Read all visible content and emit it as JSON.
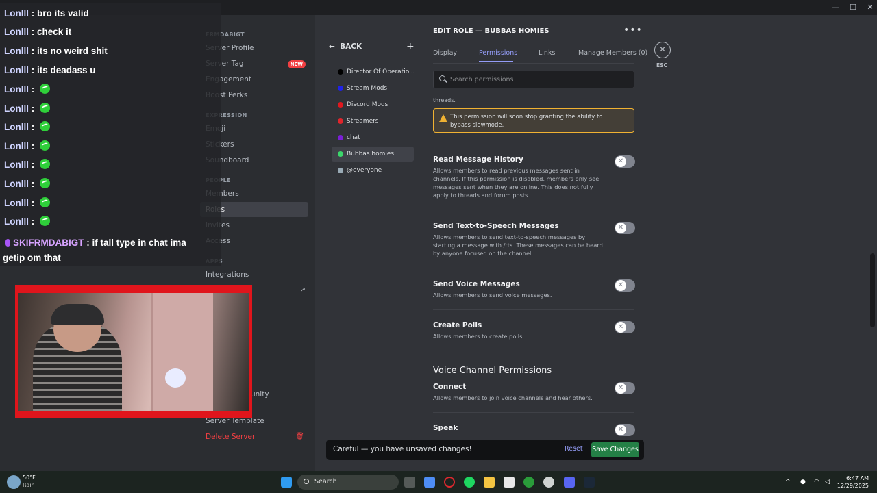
{
  "chat": {
    "lines": [
      {
        "user": "Lonlll",
        "msg": " : bro its valid"
      },
      {
        "user": "Lonlll",
        "msg": " : check it"
      },
      {
        "user": "Lonlll",
        "msg": " : its no weird shit"
      },
      {
        "user": "Lonlll",
        "msg": " : its deadass u"
      },
      {
        "user": "Lonlll",
        "msg": " : "
      },
      {
        "user": "Lonlll",
        "msg": " : "
      },
      {
        "user": "Lonlll",
        "msg": " : "
      },
      {
        "user": "Lonlll",
        "msg": " : "
      },
      {
        "user": "Lonlll",
        "msg": " : "
      },
      {
        "user": "Lonlll",
        "msg": " : "
      },
      {
        "user": "Lonlll",
        "msg": " : "
      },
      {
        "user": "Lonlll",
        "msg": " : "
      }
    ],
    "last_user": "SKIFRMDABIGT",
    "last_msg": " : if tall type in chat ima getip om that"
  },
  "sidebar": {
    "server_header": "FRMDABIGT",
    "items_top": [
      "Server Profile",
      "Server Tag",
      "Engagement",
      "Boost Perks"
    ],
    "new_badge": "NEW",
    "expression_header": "EXPRESSION",
    "expression_items": [
      "Emoji",
      "Stickers",
      "Soundboard"
    ],
    "people_header": "PEOPLE",
    "people_items": [
      "Members",
      "Roles",
      "Invites",
      "Access"
    ],
    "apps_header": "APPS",
    "apps_items": [
      "Integrations"
    ],
    "community_partial": "unity",
    "bottom_items": [
      "Server Template",
      "Delete Server"
    ]
  },
  "roles": {
    "back_label": "BACK",
    "items": [
      {
        "name": "Director Of Operatio...",
        "color": "#000000"
      },
      {
        "name": "Stream Mods",
        "color": "#1f22e8"
      },
      {
        "name": "Discord Mods",
        "color": "#e0181e"
      },
      {
        "name": "Streamers",
        "color": "#e0252c"
      },
      {
        "name": "chat",
        "color": "#7b1fd6"
      },
      {
        "name": "Bubbas homies",
        "color": "#3bd66b"
      },
      {
        "name": "@everyone",
        "color": "#99aab5"
      }
    ]
  },
  "editor": {
    "title": "EDIT ROLE — BUBBAS HOMIES",
    "tabs": [
      "Display",
      "Permissions",
      "Links",
      "Manage Members (0)"
    ],
    "esc_label": "ESC",
    "search_placeholder": "Search permissions",
    "threads_text": "threads.",
    "warning": "This permission will soon stop granting the ability to bypass slowmode.",
    "permissions": [
      {
        "title": "Read Message History",
        "desc": "Allows members to read previous messages sent in channels. If this permission is disabled, members only see messages sent when they are online. This does not fully apply to threads and forum posts.",
        "enabled": false
      },
      {
        "title": "Send Text-to-Speech Messages",
        "desc": "Allows members to send text-to-speech messages by starting a message with /tts. These messages can be heard by anyone focused on the channel.",
        "enabled": false
      },
      {
        "title": "Send Voice Messages",
        "desc": "Allows members to send voice messages.",
        "enabled": false
      },
      {
        "title": "Create Polls",
        "desc": "Allows members to create polls.",
        "enabled": false
      }
    ],
    "voice_section": "Voice Channel Permissions",
    "voice_permissions": [
      {
        "title": "Connect",
        "desc": "Allows members to join voice channels and hear others.",
        "enabled": false
      },
      {
        "title": "Speak",
        "desc": "",
        "enabled": false
      }
    ]
  },
  "unsaved": {
    "text": "Careful — you have unsaved changes!",
    "reset": "Reset",
    "save": "Save Changes"
  },
  "taskbar": {
    "temp": "50°F",
    "condition": "Rain",
    "search": "Search",
    "time": "6:47 AM",
    "date": "12/29/2025"
  },
  "colors": {
    "accent": "#949cf7",
    "save_green": "#248046",
    "danger": "#f23f42",
    "warning": "#f0b232"
  }
}
